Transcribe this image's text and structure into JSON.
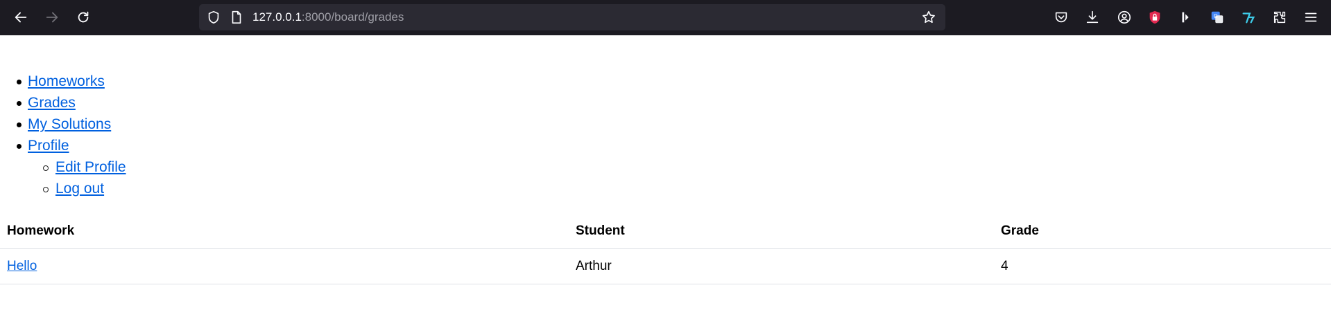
{
  "browser": {
    "url_host": "127.0.0.1",
    "url_rest": ":8000/board/grades"
  },
  "nav": {
    "items": [
      {
        "label": "Homeworks"
      },
      {
        "label": "Grades"
      },
      {
        "label": "My Solutions"
      },
      {
        "label": "Profile"
      }
    ],
    "profile_sub": [
      {
        "label": "Edit Profile"
      },
      {
        "label": "Log out"
      }
    ]
  },
  "table": {
    "headers": [
      "Homework",
      "Student",
      "Grade"
    ],
    "rows": [
      {
        "homework": "Hello",
        "student": "Arthur",
        "grade": "4"
      }
    ]
  },
  "colors": {
    "toolbar_bg": "#1c1b22",
    "urlbar_bg": "#2b2a33",
    "link": "#0060df",
    "shield_red": "#e22850"
  }
}
